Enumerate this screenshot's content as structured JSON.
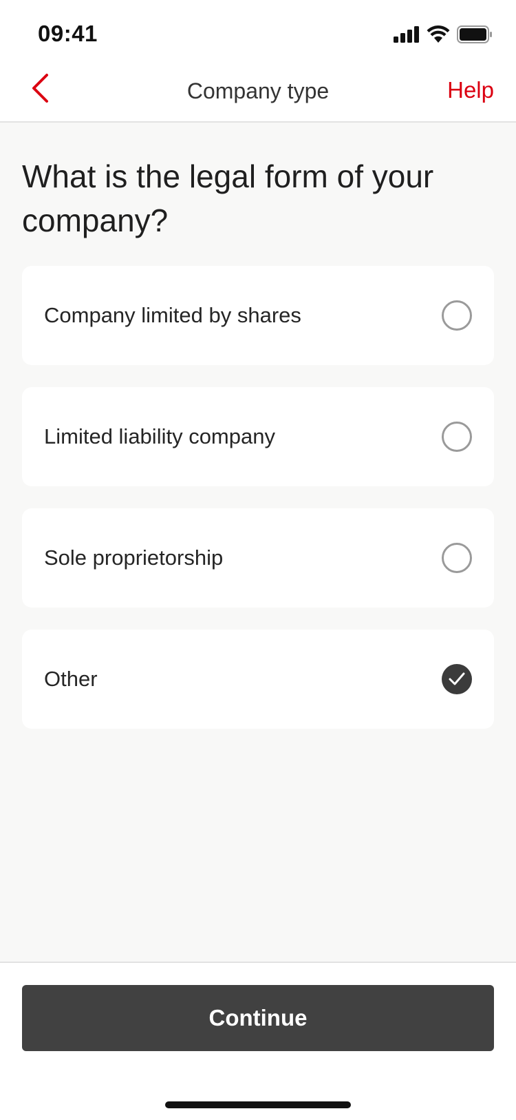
{
  "status_bar": {
    "time": "09:41",
    "icons": [
      "cellular-signal-icon",
      "wifi-icon",
      "battery-icon"
    ]
  },
  "nav": {
    "title": "Company type",
    "help_label": "Help",
    "back_icon": "chevron-left-icon"
  },
  "question": "What is the legal form of your company?",
  "options": [
    {
      "label": "Company limited by shares",
      "selected": false
    },
    {
      "label": "Limited liability company",
      "selected": false
    },
    {
      "label": "Sole proprietorship",
      "selected": false
    },
    {
      "label": "Other",
      "selected": true
    }
  ],
  "footer": {
    "continue_label": "Continue"
  },
  "colors": {
    "accent": "#db0011",
    "button": "#414141",
    "selected_radio": "#3b3b3b",
    "background": "#f8f8f7"
  }
}
